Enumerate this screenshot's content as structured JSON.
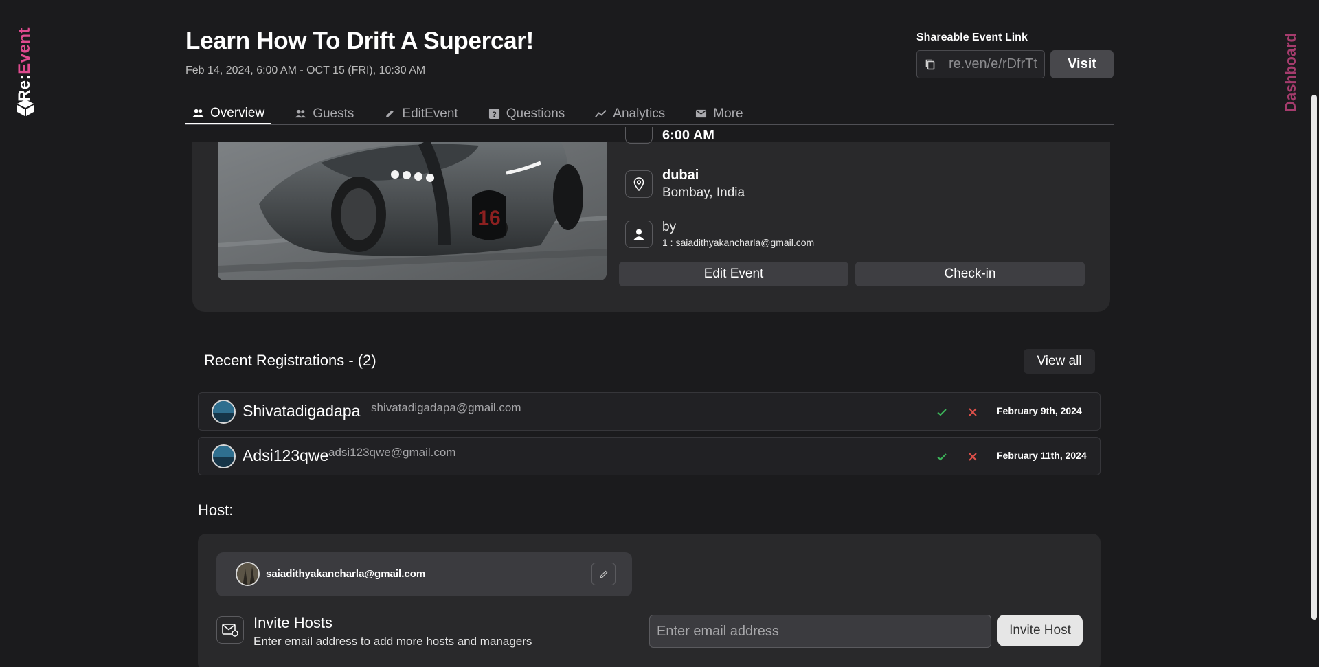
{
  "brand": {
    "name_prefix": "Re:",
    "name_suffix": "Event"
  },
  "right_rail": {
    "label": "Dashboard"
  },
  "event": {
    "title": "Learn How To Drift A Supercar!",
    "dates": "Feb 14, 2024, 6:00 AM - OCT 15 (FRI), 10:30 AM"
  },
  "share": {
    "label": "Shareable Event Link",
    "url": "re.ven/e/rDfrTt",
    "visit_label": "Visit"
  },
  "tabs": [
    {
      "label": "Overview",
      "icon": "people-icon",
      "active": true
    },
    {
      "label": "Guests",
      "icon": "people-icon",
      "active": false
    },
    {
      "label": "EditEvent",
      "icon": "pencil-icon",
      "active": false
    },
    {
      "label": "Questions",
      "icon": "question-icon",
      "active": false
    },
    {
      "label": "Analytics",
      "icon": "trend-icon",
      "active": false
    },
    {
      "label": "More",
      "icon": "mail-icon",
      "active": false
    }
  ],
  "details": {
    "time_partial": "6:00 AM",
    "location_title": "dubai",
    "location_sub": "Bombay, India",
    "host_title": "by",
    "host_sub": "1 : saiadithyakancharla@gmail.com",
    "edit_label": "Edit Event",
    "checkin_label": "Check-in"
  },
  "registrations": {
    "title": "Recent Registrations - (2)",
    "view_all_label": "View all",
    "items": [
      {
        "name": "Shivatadigadapa",
        "email": "shivatadigadapa@gmail.com",
        "date": "February 9th, 2024"
      },
      {
        "name": "Adsi123qwe",
        "email": "adsi123qwe@gmail.com",
        "date": "February 11th, 2024"
      }
    ]
  },
  "host": {
    "label": "Host:",
    "email": "saiadithyakancharla@gmail.com",
    "invite_title": "Invite Hosts",
    "invite_sub": "Enter email address to add more hosts and managers",
    "input_placeholder": "Enter email address",
    "invite_button": "Invite Host"
  },
  "colors": {
    "accent": "#e04b8f",
    "background": "#1b1b1d",
    "card": "#29292b",
    "check": "#3cb55a",
    "cross": "#e0504a"
  }
}
